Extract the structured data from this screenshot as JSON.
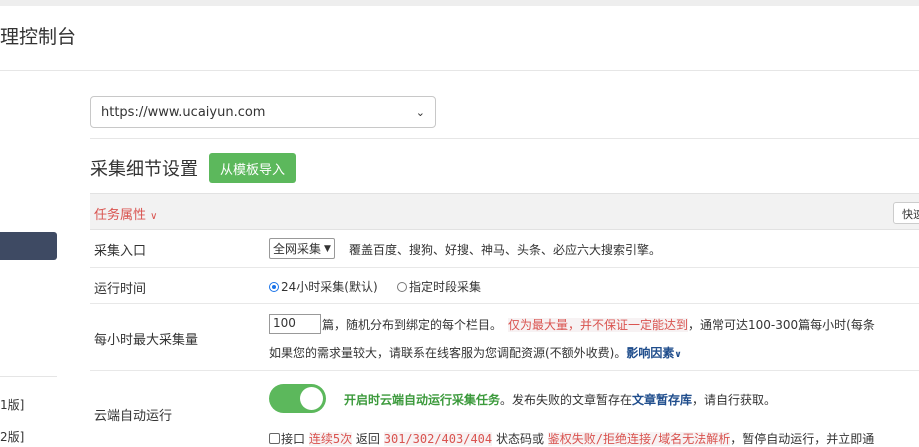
{
  "app": {
    "title": "理控制台"
  },
  "sidebar": {
    "items": [
      {
        "label": "1版]"
      },
      {
        "label": "2版]"
      }
    ]
  },
  "site_select": {
    "value": "https://www.ucaiyun.com"
  },
  "section": {
    "title": "采集细节设置",
    "import_button": "从模板导入"
  },
  "task_props": {
    "title": "任务属性 ",
    "quick_button": "快速"
  },
  "rows": {
    "entry": {
      "label": "采集入口",
      "select_value": "全网采集",
      "desc": "覆盖百度、搜狗、好搜、神马、头条、必应六大搜索引擎。"
    },
    "runtime": {
      "label": "运行时间",
      "options": [
        {
          "label": "24小时采集(默认)",
          "checked": true
        },
        {
          "label": "指定时段采集",
          "checked": false
        }
      ]
    },
    "max_per_hour": {
      "label": "每小时最大采集量",
      "value": "100",
      "text1": "篇，随机分布到绑定的每个栏目。",
      "warn": "仅为最大量，并不保证一定能达到",
      "text2": "，通常可达100-300篇每小时(每条",
      "text3": "如果您的需求量较大，请联系在线客服为您调配资源(不额外收费)。",
      "link": "影响因素"
    },
    "cloud": {
      "label": "云端自动运行",
      "toggle_on": true,
      "status": "开启时云端自动运行采集任务",
      "text1": "。发布失败的文章暂存在",
      "link": "文章暂存库",
      "text2": "，请自行获取。",
      "cb_label": "接口",
      "cb_mid1": "连续5次",
      "cb_mid2": "返回",
      "codes": "301/302/403/404",
      "cb_mid3": "状态码或",
      "reasons": "鉴权失败/拒绝连接/域名无法解析",
      "cb_tail": "，暂停自动运行，并立即通"
    }
  },
  "colors": {
    "accent_green": "#5cb85c",
    "warn_red": "#d9534f",
    "sidebar_active": "#3e4a63",
    "link_blue": "#1f4d8c"
  },
  "icons": {
    "select_chevron": "chevron-down-icon",
    "dropdown_red": "double-chevron-down-icon",
    "link_expand": "double-chevron-down-icon"
  }
}
